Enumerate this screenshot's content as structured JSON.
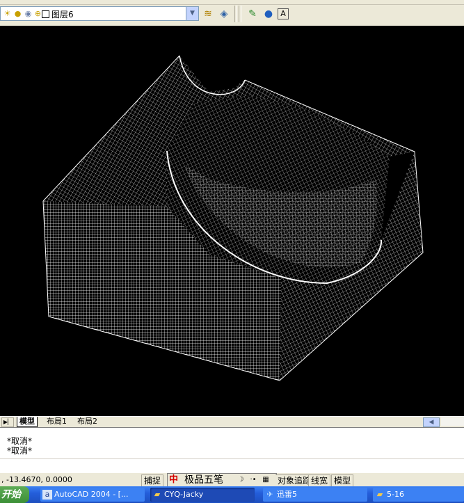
{
  "toolbar": {
    "layer_name": "图层6",
    "icons": [
      "lightbulb-icon",
      "sun-icon",
      "color-icon",
      "lock-icon",
      "square-icon",
      "layer-states-icon",
      "layer-previous-icon",
      "render-icon",
      "sphere-icon",
      "hide-icon"
    ]
  },
  "tabs": {
    "model": "模型",
    "layout1": "布局1",
    "layout2": "布局2"
  },
  "command": {
    "history": [
      "*取消*",
      "*取消*"
    ],
    "prompt": ""
  },
  "status": {
    "coords": ", -13.4670, 0.0000",
    "snap": "捕捉",
    "otrack": "对象追踪",
    "lineweight": "线宽",
    "model": "模型"
  },
  "ime": {
    "name": "极品五笔",
    "logo": "中"
  },
  "taskbar": {
    "start": "开始",
    "tasks": [
      {
        "label": "AutoCAD 2004 - [..."
      },
      {
        "label": "CYQ-Jacky"
      },
      {
        "label": "迅雷5"
      },
      {
        "label": "5-16"
      }
    ]
  },
  "colors": {
    "canvas": "#000000",
    "wire": "#ffffff",
    "taskbar": "#245edb"
  }
}
